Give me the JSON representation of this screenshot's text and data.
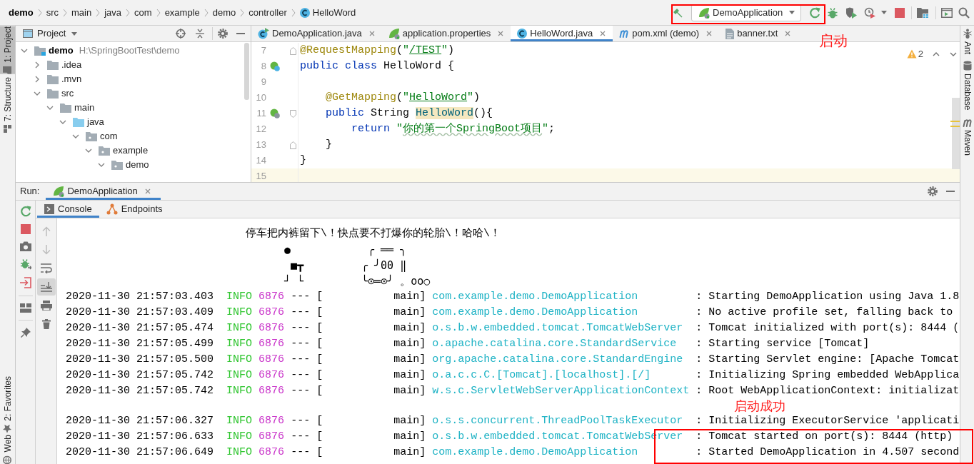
{
  "breadcrumb": [
    {
      "label": "demo",
      "kind": "project"
    },
    {
      "label": "src",
      "kind": "folder"
    },
    {
      "label": "main",
      "kind": "folder"
    },
    {
      "label": "java",
      "kind": "folder"
    },
    {
      "label": "com",
      "kind": "folder"
    },
    {
      "label": "example",
      "kind": "folder"
    },
    {
      "label": "demo",
      "kind": "folder"
    },
    {
      "label": "controller",
      "kind": "folder"
    },
    {
      "label": "HelloWord",
      "kind": "class"
    }
  ],
  "toolbar": {
    "run_configuration": "DemoApplication"
  },
  "left_strip": {
    "top": [
      {
        "label": "1: Project",
        "selected": true
      },
      {
        "label": "7: Structure",
        "selected": false
      }
    ],
    "bottom": [
      {
        "label": "2: Favorites",
        "selected": false
      },
      {
        "label": "Web",
        "selected": false
      }
    ]
  },
  "project_panel": {
    "title": "Project",
    "tree": [
      {
        "label": "demo",
        "path": "H:\\SpringBootTest\\demo",
        "kind": "module",
        "expanded": true,
        "children": [
          {
            "label": ".idea",
            "kind": "folder",
            "expanded": false
          },
          {
            "label": ".mvn",
            "kind": "folder",
            "expanded": false
          },
          {
            "label": "src",
            "kind": "folder",
            "expanded": true,
            "children": [
              {
                "label": "main",
                "kind": "folder",
                "expanded": true,
                "children": [
                  {
                    "label": "java",
                    "kind": "source",
                    "expanded": true,
                    "children": [
                      {
                        "label": "com",
                        "kind": "package",
                        "expanded": true,
                        "children": [
                          {
                            "label": "example",
                            "kind": "package",
                            "expanded": true,
                            "children": [
                              {
                                "label": "demo",
                                "kind": "package",
                                "expanded": true
                              }
                            ]
                          }
                        ]
                      }
                    ]
                  }
                ]
              }
            ]
          }
        ]
      }
    ]
  },
  "editor": {
    "tabs": [
      {
        "label": "DemoApplication.java",
        "kind": "spring-class",
        "selected": false
      },
      {
        "label": "application.properties",
        "kind": "properties",
        "selected": false
      },
      {
        "label": "HelloWord.java",
        "kind": "class",
        "selected": true
      },
      {
        "label": "pom.xml (demo)",
        "kind": "maven",
        "selected": false
      },
      {
        "label": "banner.txt",
        "kind": "text",
        "selected": false
      }
    ],
    "warnings": "2",
    "lines": [
      {
        "number": "7",
        "current": false,
        "markers": [
          {
            "kind": "fold-end"
          }
        ],
        "tokens": [
          {
            "text": "@RequestMapping",
            "kind": "annotation"
          },
          {
            "text": "(",
            "kind": "plain"
          },
          {
            "text": "\"",
            "kind": "string"
          },
          {
            "text": "/TEST",
            "kind": "url"
          },
          {
            "text": "\"",
            "kind": "string"
          },
          {
            "text": ")",
            "kind": "plain"
          }
        ]
      },
      {
        "number": "8",
        "current": false,
        "markers": [
          {
            "kind": "bean-class"
          }
        ],
        "tokens": [
          {
            "text": "public class",
            "kind": "keyword"
          },
          {
            "text": " HelloWord {",
            "kind": "plain"
          }
        ]
      },
      {
        "number": "9",
        "current": false
      },
      {
        "number": "10",
        "current": false,
        "tokens": [
          {
            "text": "    @GetMapping",
            "kind": "annotation"
          },
          {
            "text": "(",
            "kind": "plain"
          },
          {
            "text": "\"",
            "kind": "string"
          },
          {
            "text": "HelloWord",
            "kind": "url"
          },
          {
            "text": "\"",
            "kind": "string"
          },
          {
            "text": ")",
            "kind": "plain"
          }
        ]
      },
      {
        "number": "11",
        "current": false,
        "markers": [
          {
            "kind": "bean-method"
          },
          {
            "kind": "fold-start"
          }
        ],
        "tokens": [
          {
            "text": "    public",
            "kind": "keyword"
          },
          {
            "text": " String ",
            "kind": "plain"
          },
          {
            "text": "HelloWord",
            "kind": "method"
          },
          {
            "text": "(){",
            "kind": "plain"
          }
        ]
      },
      {
        "number": "12",
        "current": false,
        "tokens": [
          {
            "text": "        return",
            "kind": "keyword"
          },
          {
            "text": " \"",
            "kind": "string"
          },
          {
            "text": "你的第一个SpringBoot项目",
            "kind": "typo"
          },
          {
            "text": "\"",
            "kind": "string"
          },
          {
            "text": ";",
            "kind": "plain"
          }
        ]
      },
      {
        "number": "13",
        "current": false,
        "markers": [
          {
            "kind": "fold-end"
          }
        ],
        "tokens": [
          {
            "text": "    }",
            "kind": "plain"
          }
        ]
      },
      {
        "number": "14",
        "current": false,
        "tokens": [
          {
            "text": "}",
            "kind": "plain"
          }
        ]
      },
      {
        "number": "15",
        "current": true
      }
    ]
  },
  "right_strip": [
    {
      "label": "Ant"
    },
    {
      "label": "Database"
    },
    {
      "label": "Maven"
    }
  ],
  "run_panel": {
    "label": "Run:",
    "tabs": [
      {
        "label": "DemoApplication",
        "selected": true
      }
    ],
    "console_tabs": [
      {
        "label": "Console",
        "selected": true
      },
      {
        "label": "Endpoints",
        "selected": false
      }
    ],
    "console_toolbar": [
      {
        "selected": false,
        "disabled": true
      },
      {
        "selected": false,
        "disabled": true
      },
      {
        "selected": false,
        "disabled": false
      },
      {
        "selected": true,
        "disabled": false
      },
      {
        "selected": false,
        "disabled": false
      },
      {
        "selected": false,
        "disabled": false
      }
    ],
    "banner": {
      "slogan": "停车把内裤留下\\！快点要不打爆你的轮胎\\！哈哈\\！",
      "figure": "●\n ■┳\n┘ └",
      "car": " ╭ ══ ╮\n╭ ╯00 ‖\n╰⊙═⊙╯ 。oo○"
    },
    "log": [
      {
        "timestamp": "2020-11-30 21:57:03.403",
        "level": "INFO",
        "pid": "6876",
        "thread": "--- [           main]",
        "logger": "com.example.demo.DemoApplication",
        "message": ": Starting DemoApplication using Java 1.8"
      },
      {
        "timestamp": "2020-11-30 21:57:03.409",
        "level": "INFO",
        "pid": "6876",
        "thread": "--- [           main]",
        "logger": "com.example.demo.DemoApplication",
        "message": ": No active profile set, falling back to"
      },
      {
        "timestamp": "2020-11-30 21:57:05.474",
        "level": "INFO",
        "pid": "6876",
        "thread": "--- [           main]",
        "logger": "o.s.b.w.embedded.tomcat.TomcatWebServer",
        "message": ": Tomcat initialized with port(s): 8444 ("
      },
      {
        "timestamp": "2020-11-30 21:57:05.499",
        "level": "INFO",
        "pid": "6876",
        "thread": "--- [           main]",
        "logger": "o.apache.catalina.core.StandardService",
        "message": ": Starting service [Tomcat]"
      },
      {
        "timestamp": "2020-11-30 21:57:05.500",
        "level": "INFO",
        "pid": "6876",
        "thread": "--- [           main]",
        "logger": "org.apache.catalina.core.StandardEngine",
        "message": ": Starting Servlet engine: [Apache Tomcat"
      },
      {
        "timestamp": "2020-11-30 21:57:05.742",
        "level": "INFO",
        "pid": "6876",
        "thread": "--- [           main]",
        "logger": "o.a.c.c.C.[Tomcat].[localhost].[/]",
        "message": ": Initializing Spring embedded WebApplica"
      },
      {
        "timestamp": "2020-11-30 21:57:05.742",
        "level": "INFO",
        "pid": "6876",
        "thread": "--- [           main]",
        "logger": "w.s.c.ServletWebServerApplicationContext",
        "message": ": Root WebApplicationContext: initializat"
      },
      {
        "timestamp": "2020-11-30 21:57:06.327",
        "level": "INFO",
        "pid": "6876",
        "thread": "--- [           main]",
        "logger": "o.s.s.concurrent.ThreadPoolTaskExecutor",
        "message": ": Initializing ExecutorService 'applicati"
      },
      {
        "timestamp": "2020-11-30 21:57:06.633",
        "level": "INFO",
        "pid": "6876",
        "thread": "--- [           main]",
        "logger": "o.s.b.w.embedded.tomcat.TomcatWebServer",
        "message": ": Tomcat started on port(s): 8444 (http)"
      },
      {
        "timestamp": "2020-11-30 21:57:06.649",
        "level": "INFO",
        "pid": "6876",
        "thread": "--- [           main]",
        "logger": "com.example.demo.DemoApplication",
        "message": ": Started DemoApplication in 4.507 second"
      }
    ]
  },
  "callouts": [
    {
      "label": "启动"
    },
    {
      "label": "启动成功"
    }
  ]
}
